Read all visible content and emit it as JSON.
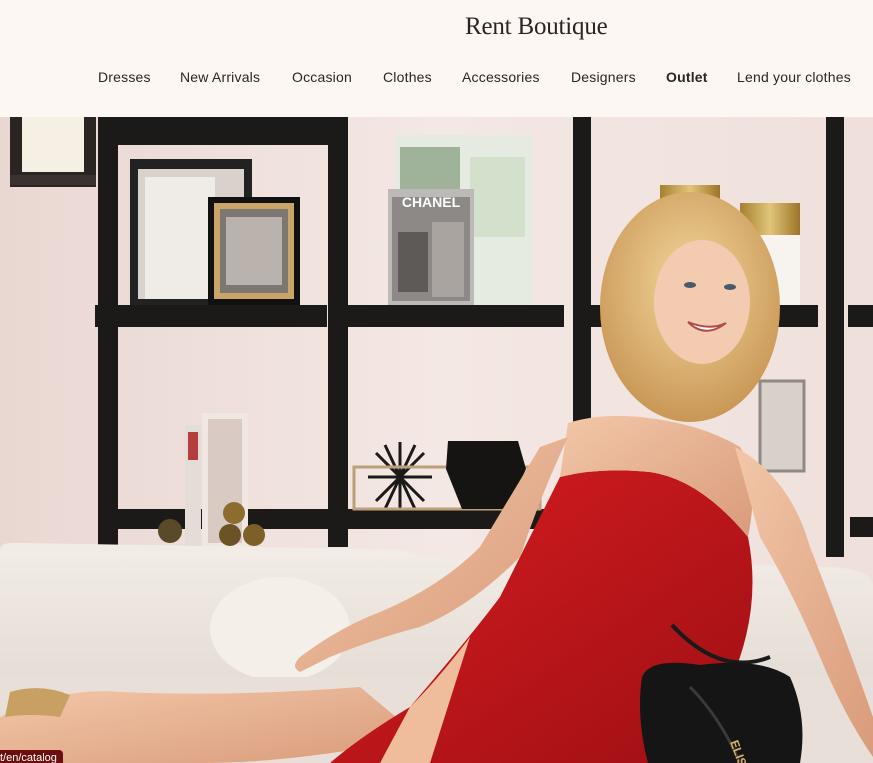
{
  "brand": {
    "name": "Rent Boutique"
  },
  "nav": {
    "items": [
      {
        "label": "Dresses"
      },
      {
        "label": "New Arrivals"
      },
      {
        "label": "Occasion"
      },
      {
        "label": "Clothes"
      },
      {
        "label": "Accessories"
      },
      {
        "label": "Designers"
      },
      {
        "label": "Outlet",
        "active": true
      },
      {
        "label": "Lend your clothes"
      }
    ]
  },
  "hero": {
    "book_title": "CHANEL",
    "bag_text": "ELISAB"
  },
  "status_bar": {
    "url": "t/en/catalog"
  },
  "colors": {
    "header_bg": "#fcf7f3",
    "dress_red": "#c4151b",
    "shelf_black": "#1c1a19"
  }
}
